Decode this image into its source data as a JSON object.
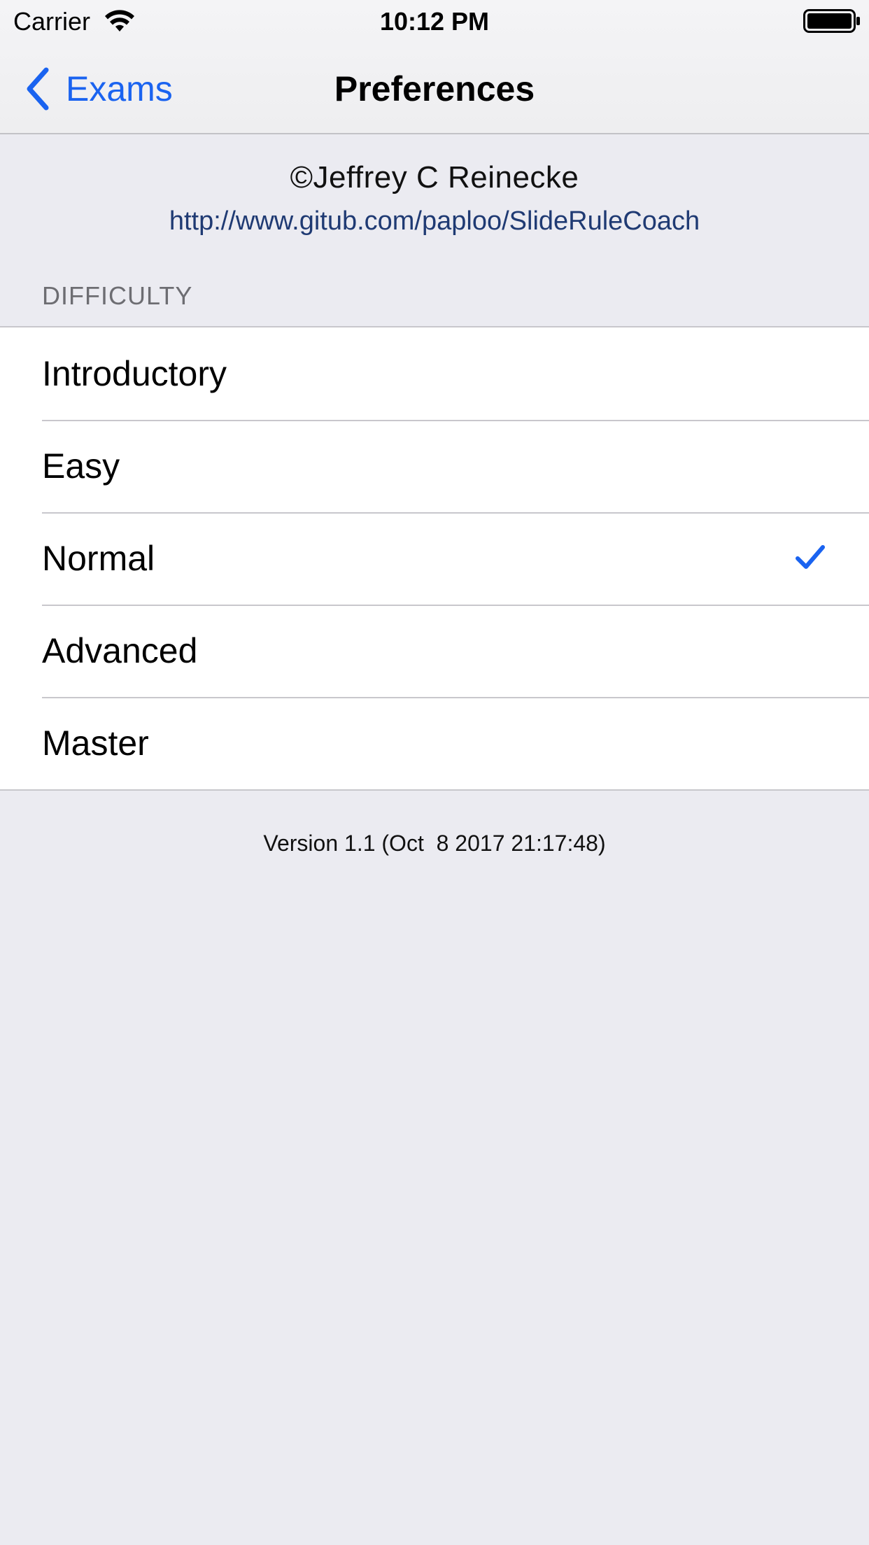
{
  "status_bar": {
    "carrier": "Carrier",
    "time": "10:12 PM",
    "wifi_icon": "wifi-icon",
    "battery_icon": "battery-icon"
  },
  "nav": {
    "back_label": "Exams",
    "back_icon": "chevron-left-icon",
    "title": "Preferences"
  },
  "credits": {
    "copyright": "©Jeffrey C Reinecke",
    "url": "http://www.gitub.com/paploo/SlideRuleCoach"
  },
  "difficulty": {
    "header": "DIFFICULTY",
    "options": [
      {
        "label": "Introductory"
      },
      {
        "label": "Easy"
      },
      {
        "label": "Normal"
      },
      {
        "label": "Advanced"
      },
      {
        "label": "Master"
      }
    ],
    "selected": "Normal"
  },
  "footer": {
    "version": "Version 1.1 (Oct  8 2017 21:17:48)"
  },
  "colors": {
    "accent": "#1a63f0",
    "link": "#1f3a73",
    "background": "#ebebf1",
    "section_header": "#6d6d72"
  }
}
